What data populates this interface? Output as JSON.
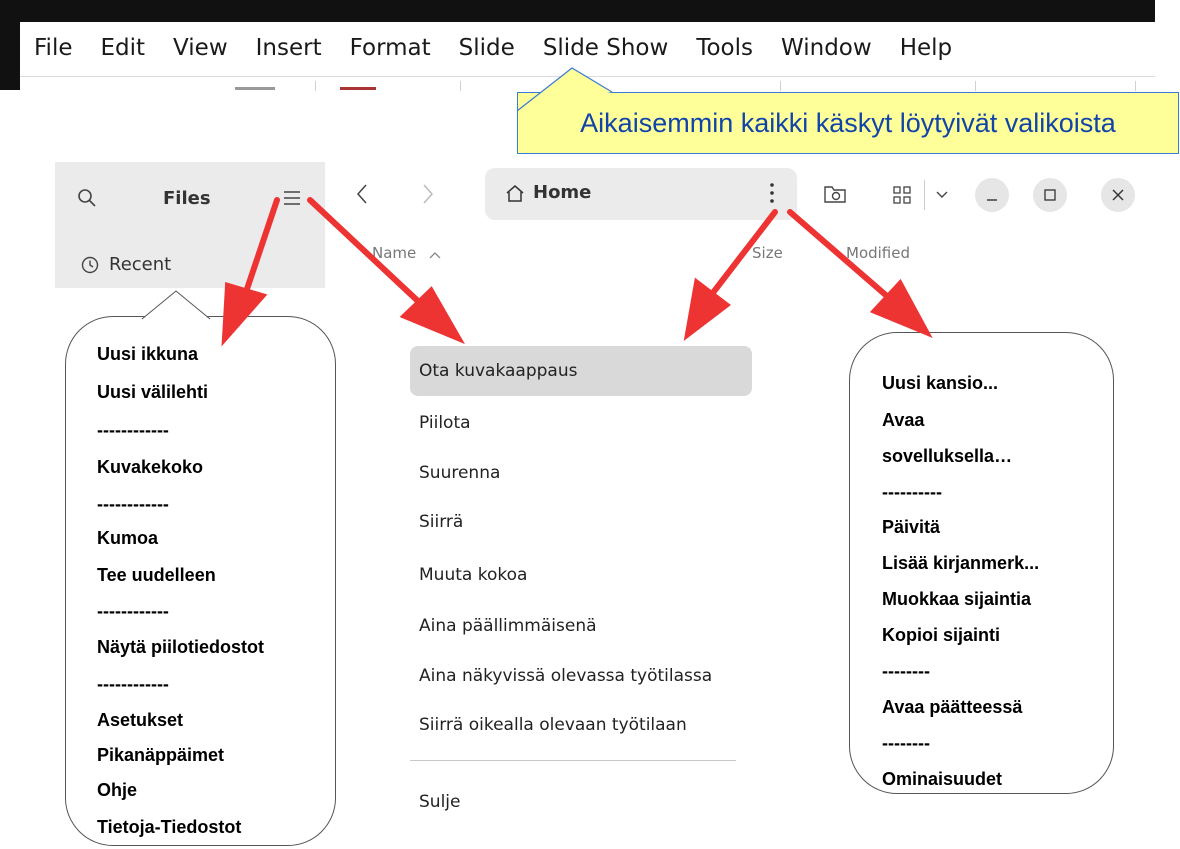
{
  "lo_menubar": {
    "items": [
      "File",
      "Edit",
      "View",
      "Insert",
      "Format",
      "Slide",
      "Slide Show",
      "Tools",
      "Window",
      "Help"
    ]
  },
  "callout": {
    "text": "Aikaisemmin kaikki käskyt löytyivät valikoista"
  },
  "files_window": {
    "app_title": "Files",
    "sidebar_recent": "Recent",
    "path_label": "Home",
    "columns": {
      "name": "Name",
      "size": "Size",
      "modified": "Modified"
    }
  },
  "left_balloon": {
    "items": [
      "Uusi ikkuna",
      "Uusi välilehti",
      "------------",
      "Kuvakekoko",
      "------------",
      "Kumoa",
      "Tee uudelleen",
      "------------",
      "Näytä piilotiedostot",
      "------------",
      "Asetukset",
      "Pikanäppäimet",
      "Ohje",
      "Tietoja-Tiedostot"
    ]
  },
  "window_menu": {
    "items": [
      "Ota kuvakaappaus",
      "Piilota",
      "Suurenna",
      "Siirrä",
      "Muuta kokoa",
      "Aina päällimmäisenä",
      "Aina näkyvissä olevassa työtilassa",
      "Siirrä oikealla olevaan työtilaan"
    ],
    "close": "Sulje",
    "highlighted_index": 0
  },
  "right_balloon": {
    "items": [
      "Uusi kansio...",
      "Avaa",
      "sovelluksella…",
      "----------",
      "Päivitä",
      "Lisää kirjanmerk...",
      "Muokkaa sijaintia",
      "Kopioi sijainti",
      "--------",
      "Avaa päätteessä",
      "--------",
      "Ominaisuudet"
    ]
  },
  "colors": {
    "arrow": "#ee3333",
    "callout_bg": "#ffff99",
    "callout_text": "#1144aa",
    "header_bg": "#ebebeb"
  }
}
